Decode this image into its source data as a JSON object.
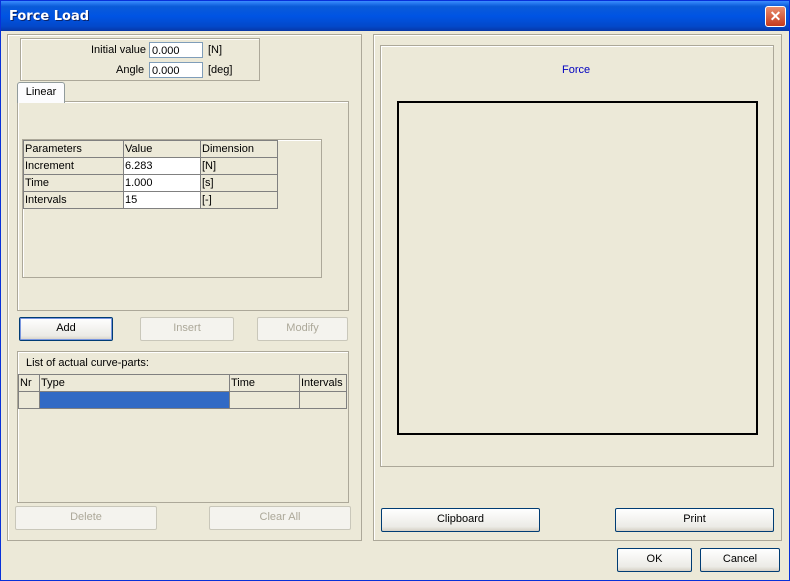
{
  "window": {
    "title": "Force Load"
  },
  "inputs": {
    "initial_value": {
      "label": "Initial value",
      "value": "0.000",
      "unit": "[N]"
    },
    "angle": {
      "label": "Angle",
      "value": "0.000",
      "unit": "[deg]"
    }
  },
  "tab": {
    "label": "Linear"
  },
  "parameters_table": {
    "headers": [
      "Parameters",
      "Value",
      "Dimension"
    ],
    "rows": [
      {
        "name": "Increment",
        "value": "6.283",
        "dimension": "[N]"
      },
      {
        "name": "Time",
        "value": "1.000",
        "dimension": "[s]"
      },
      {
        "name": "Intervals",
        "value": "15",
        "dimension": "[-]"
      }
    ]
  },
  "buttons": {
    "add": "Add",
    "insert": "Insert",
    "modify": "Modify",
    "delete": "Delete",
    "clear_all": "Clear All",
    "clipboard": "Clipboard",
    "print": "Print",
    "ok": "OK",
    "cancel": "Cancel"
  },
  "curve_list": {
    "title": "List of actual curve-parts:",
    "headers": [
      "Nr",
      "Type",
      "Time",
      "Intervals"
    ]
  },
  "graph": {
    "title": "Force"
  },
  "colors": {
    "title_bar": "#0054e3",
    "selected_row": "#316ac5",
    "graph_title": "#0000c0"
  }
}
